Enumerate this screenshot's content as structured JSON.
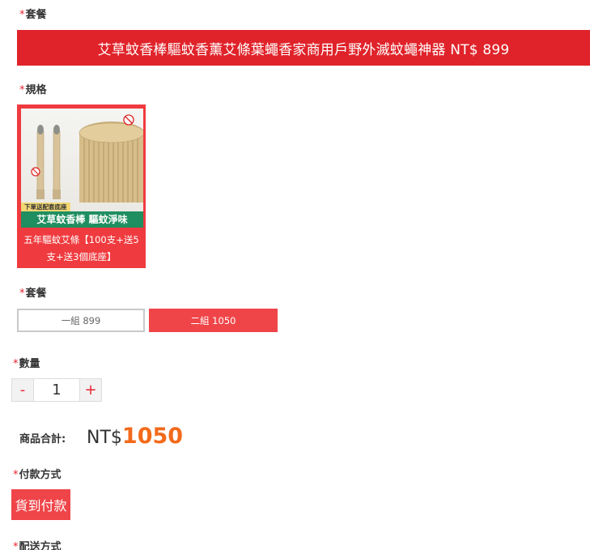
{
  "sections": {
    "package_top_label": "套餐",
    "spec_label": "規格",
    "package_label": "套餐",
    "quantity_label": "數量",
    "payment_label": "付款方式",
    "shipping_label": "配送方式",
    "required_mark": "*"
  },
  "banner": {
    "title": "艾草蚊香棒驅蚊香薰艾條葉蠅香家商用戶野外滅蚊蠅神器 NT$ 899"
  },
  "spec": {
    "image_banner": "艾草蚊香棒 驅蚊淨味",
    "image_tag": "下單送配套底座",
    "caption": "五年驅蚊艾條【100支+送5支+送3個底座】"
  },
  "package_options": [
    {
      "label": "一組 899",
      "selected": false
    },
    {
      "label": "二組 1050",
      "selected": true
    }
  ],
  "quantity": {
    "minus": "-",
    "value": "1",
    "plus": "+"
  },
  "total": {
    "label": "商品合計:",
    "currency": "NT$",
    "amount": "1050"
  },
  "payment": {
    "option": "貨到付款"
  },
  "colors": {
    "accent_red": "#e0232a",
    "button_red": "#ef4549",
    "price_orange": "#f26a1b",
    "image_banner_green": "#1f8e60"
  }
}
